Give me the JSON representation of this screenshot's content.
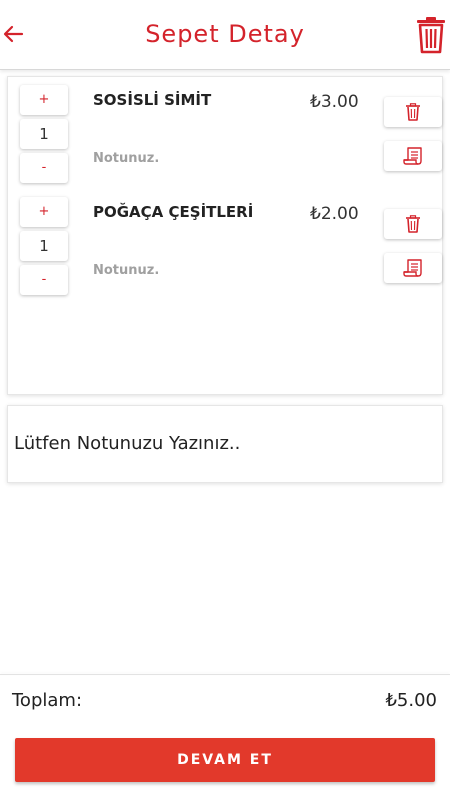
{
  "colors": {
    "accent": "#d4232b",
    "button": "#e2392b",
    "text": "#222222",
    "muted": "#a0a0a0"
  },
  "header": {
    "title": "Sepet Detay",
    "back_icon": "arrow-left-icon",
    "clear_icon": "trash-icon"
  },
  "items": [
    {
      "increment_label": "+",
      "quantity": "1",
      "decrement_label": "-",
      "name": "SOSİSLİ SİMİT",
      "price": "₺3.00",
      "note_placeholder": "Notunuz.",
      "delete_icon": "trash-icon",
      "note_icon": "receipt-note-icon"
    },
    {
      "increment_label": "+",
      "quantity": "1",
      "decrement_label": "-",
      "name": "POĞAÇA ÇEŞİTLERİ",
      "price": "₺2.00",
      "note_placeholder": "Notunuz.",
      "delete_icon": "trash-icon",
      "note_icon": "receipt-note-icon"
    }
  ],
  "note": {
    "placeholder": "Lütfen Notunuzu Yazınız.."
  },
  "footer": {
    "total_label": "Toplam:",
    "total_value": "₺5.00",
    "continue_label": "DEVAM ET"
  }
}
